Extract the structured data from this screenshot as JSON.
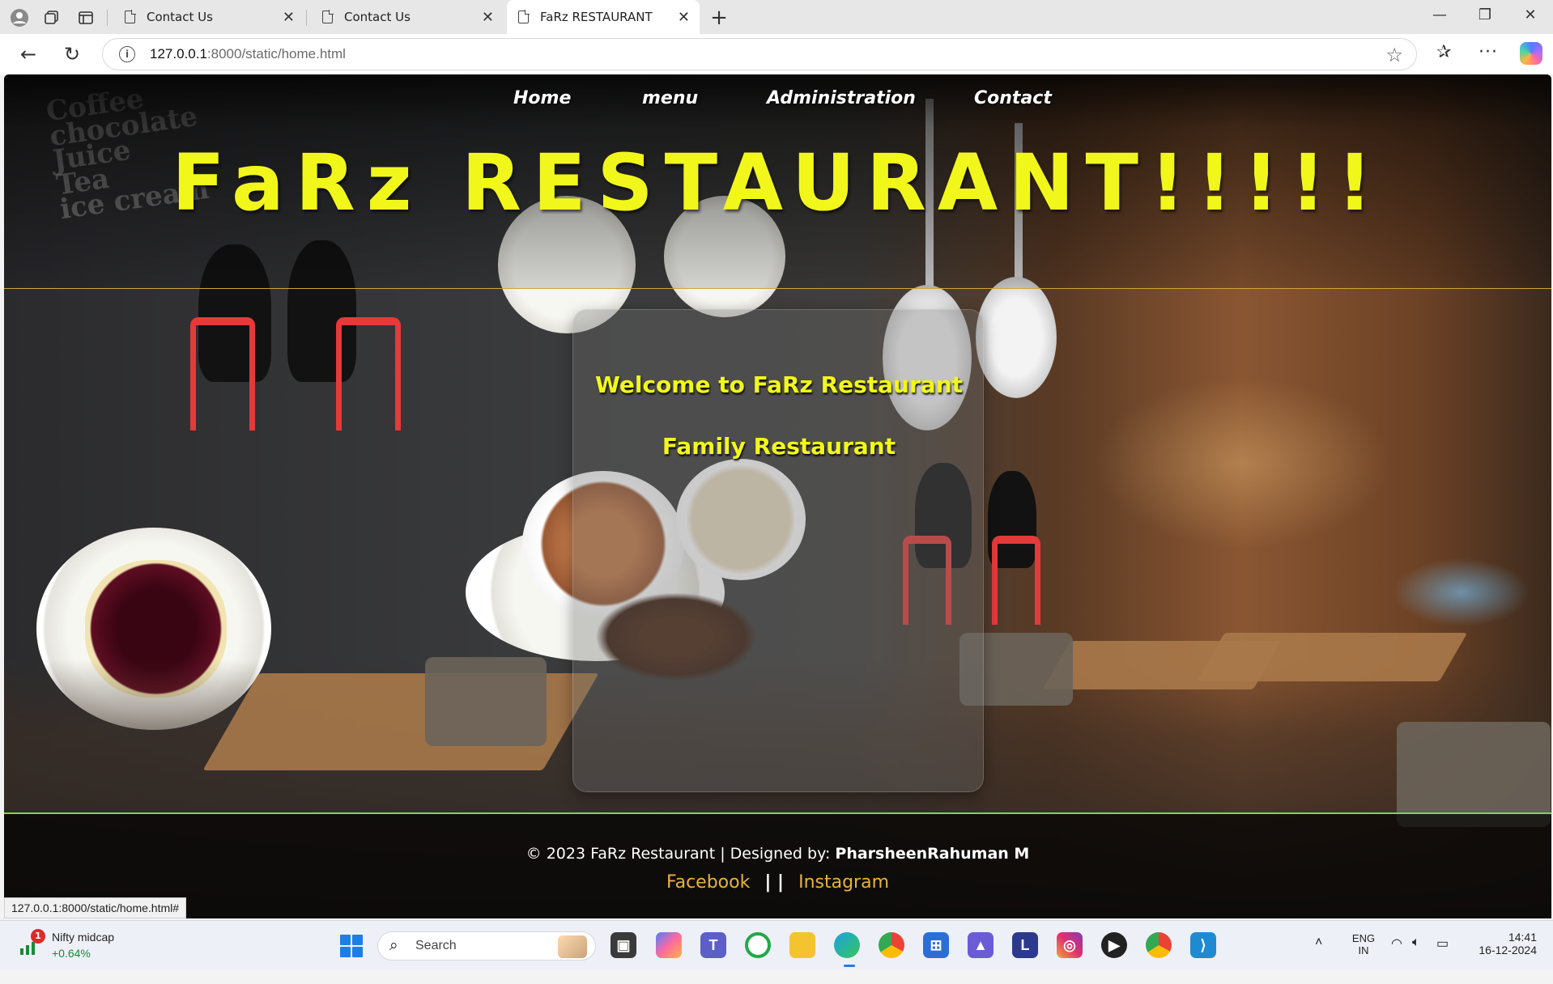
{
  "browser": {
    "tabs": [
      {
        "title": "Contact Us"
      },
      {
        "title": "Contact Us"
      },
      {
        "title": "FaRz RESTAURANT"
      }
    ],
    "url_host": "127.0.0.1",
    "url_path": ":8000/static/home.html",
    "status_url": "127.0.0.1:8000/static/home.html#"
  },
  "site": {
    "nav": [
      "Home",
      "menu",
      "Administration",
      "Contact"
    ],
    "title": "FaRz RESTAURANT!!!!!",
    "welcome": "Welcome to FaRz Restaurant",
    "tagline": "Family Restaurant",
    "footer": {
      "copyright": "© 2023 FaRz Restaurant | Designed by: ",
      "designer": "PharsheenRahuman M",
      "facebook": "Facebook",
      "separator": "| |",
      "instagram": "Instagram"
    }
  },
  "taskbar": {
    "stock_name": "Nifty midcap",
    "stock_change": "+0.64%",
    "stock_badge": "1",
    "search_label": "Search",
    "lang_top": "ENG",
    "lang_bottom": "IN",
    "time": "14:41",
    "date": "16-12-2024"
  },
  "colors": {
    "title_yellow": "#f2f71b",
    "footer_link": "#e8b33b",
    "header_rule": "#d0a23c",
    "footer_rule": "#7bd84b"
  }
}
